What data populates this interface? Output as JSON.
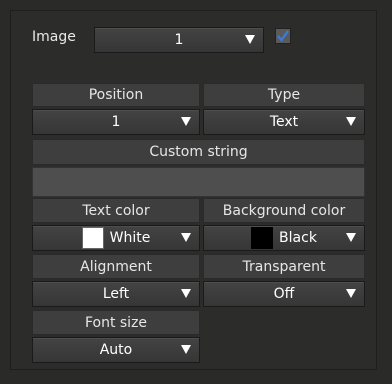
{
  "image_row": {
    "label": "Image",
    "selected": "1",
    "checkbox_checked": true
  },
  "position": {
    "header": "Position",
    "value": "1"
  },
  "type": {
    "header": "Type",
    "value": "Text"
  },
  "custom_string": {
    "header": "Custom string",
    "value": ""
  },
  "text_color": {
    "header": "Text color",
    "value": "White",
    "swatch": "#ffffff"
  },
  "background_color": {
    "header": "Background color",
    "value": "Black",
    "swatch": "#000000"
  },
  "alignment": {
    "header": "Alignment",
    "value": "Left"
  },
  "transparent": {
    "header": "Transparent",
    "value": "Off"
  },
  "font_size": {
    "header": "Font size",
    "value": "Auto"
  },
  "colors": {
    "accent_check": "#3a7bd5"
  }
}
